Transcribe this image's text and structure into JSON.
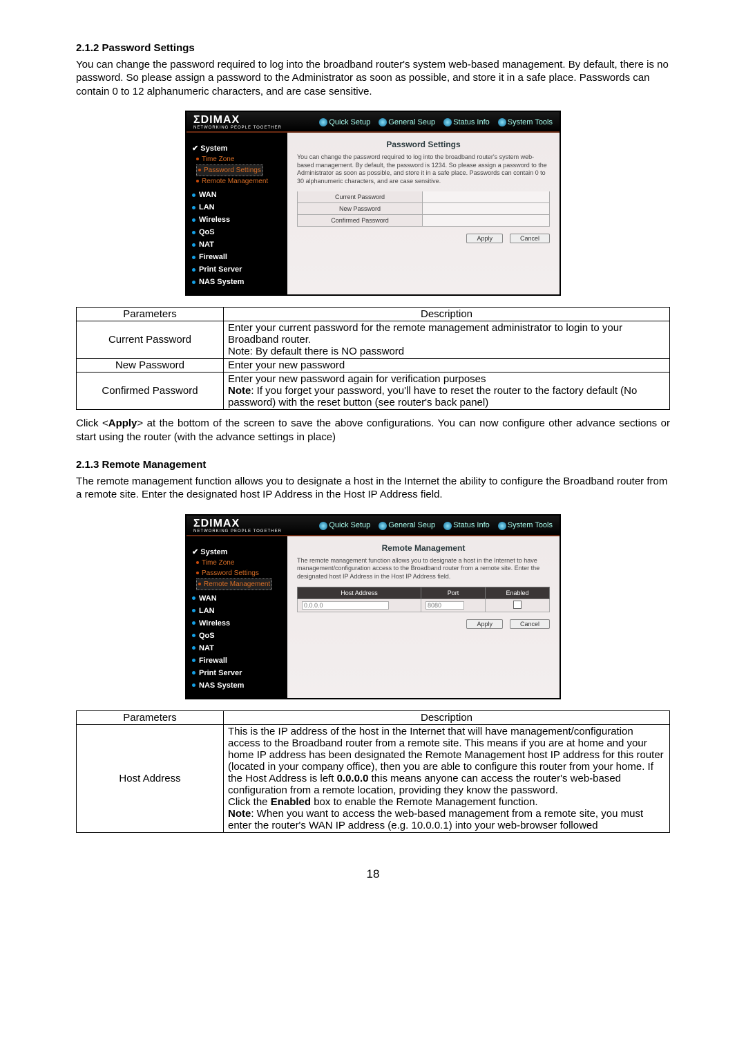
{
  "page_number": "18",
  "section_212": {
    "title": "2.1.2 Password Settings",
    "paragraph": "You can change the password required to log into the broadband router's system web-based management. By default, there is no password. So please assign a password to the Administrator as soon as possible, and store it in a safe place. Passwords can contain 0 to 12 alphanumeric characters, and are case sensitive."
  },
  "router_ui": {
    "logo": "ΣDIMAX",
    "logo_sub": "NETWORKING PEOPLE TOGETHER",
    "tabs": [
      "Quick Setup",
      "General Seup",
      "Status Info",
      "System Tools"
    ],
    "sidebar": {
      "system": "System",
      "system_subs": [
        "Time Zone",
        "Password Settings",
        "Remote Management"
      ],
      "items": [
        "WAN",
        "LAN",
        "Wireless",
        "QoS",
        "NAT",
        "Firewall",
        "Print Server",
        "NAS System"
      ]
    },
    "pw": {
      "title": "Password Settings",
      "desc": "You can change the password required to log into the broadband router's system web-based management. By default, the password is 1234. So please assign a password to the Administrator as soon as possible, and store it in a safe place. Passwords can contain 0 to 30 alphanumeric characters, and are case sensitive.",
      "fields": [
        "Current Password",
        "New Password",
        "Confirmed Password"
      ],
      "apply": "Apply",
      "cancel": "Cancel"
    },
    "rm": {
      "title": "Remote Management",
      "desc": "The remote management function allows you to designate a host in the Internet to have management/configuration access to the Broadband router from a remote site. Enter the designated host IP Address in the Host IP Address field.",
      "cols": [
        "Host Address",
        "Port",
        "Enabled"
      ],
      "host_val": "0.0.0.0",
      "port_val": "8080",
      "apply": "Apply",
      "cancel": "Cancel"
    }
  },
  "table_212": {
    "head_param": "Parameters",
    "head_desc": "Description",
    "rows": [
      {
        "p": "Current Password",
        "d": "Enter your current password for the remote management administrator to login to your Broadband router.\nNote: By default there is NO password"
      },
      {
        "p": "New Password",
        "d": "Enter your new password"
      },
      {
        "p": "Confirmed Password",
        "d": "Enter your new password again for verification purposes\n<b>Note</b>: If you forget your password, you'll have to reset the router to the factory default (No password) with the reset button (see router's back panel)"
      }
    ]
  },
  "after_212": {
    "text_a": "Click <",
    "text_apply": "Apply",
    "text_b": "> at the bottom of the screen to save the above configurations. You can now configure other advance sections or start using the router (with the advance settings in place)"
  },
  "section_213": {
    "title": "2.1.3 Remote Management",
    "paragraph": "The remote management function allows you to designate a host in the Internet the ability to configure the Broadband router from a remote site. Enter the designated host IP Address in the Host IP Address field."
  },
  "table_213": {
    "head_param": "Parameters",
    "head_desc": "Description",
    "rows": [
      {
        "p": "Host Address",
        "d": "This is the IP address of the host in the Internet that will have management/configuration access to the Broadband router from a remote site. This means if you are at home and your home IP address has been designated the Remote Management host IP address for this router (located in your company office), then you are able to configure this router from your home. If the Host Address is left <b>0.0.0.0</b> this means anyone can access the router's web-based configuration from a remote location, providing they know the password.\nClick the <b>Enabled</b> box to enable the Remote Management function.\n<b>Note</b>: When you want to access the web-based management from a remote site, you must enter the router's WAN IP address (e.g. 10.0.0.1) into your web-browser followed"
      }
    ]
  }
}
